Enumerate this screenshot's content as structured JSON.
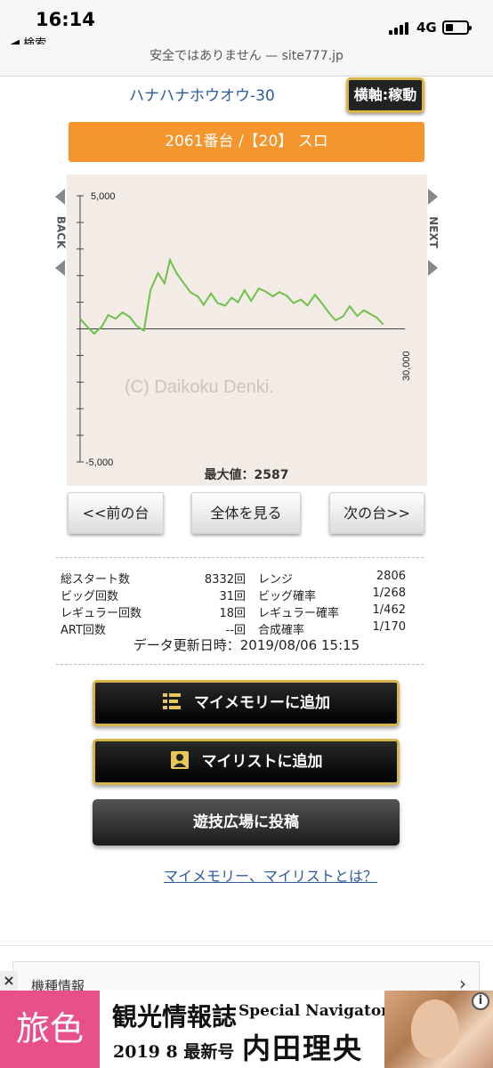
{
  "status_bar": {
    "time": "16:14",
    "back_app": "◀ 検索",
    "network": "4G"
  },
  "url_bar": {
    "text": "安全ではありません — site777.jp"
  },
  "header": {
    "model_name": "ハナハナホウオウ-30",
    "axis_button": "横軸:稼動",
    "machine": "2061番台 /【20】 スロ"
  },
  "chart_data": {
    "type": "line",
    "title": "",
    "xlabel": "",
    "ylabel": "",
    "x_tick_labels": [
      "30,000"
    ],
    "y_tick_labels": [
      "5,000",
      "-5,000"
    ],
    "ylim": [
      -5000,
      5000
    ],
    "xlim": [
      0,
      30000
    ],
    "grid": false,
    "watermark": "(C) Daikoku Denki.",
    "max_label": "最大値：2587",
    "series": [
      {
        "color": "#6ec24a",
        "x": [
          0,
          700,
          1300,
          2000,
          2600,
          3300,
          3900,
          4600,
          5200,
          5900,
          6500,
          7200,
          7800,
          8300,
          8900,
          9600,
          10200,
          10900,
          11400,
          12100,
          12700,
          13400,
          14000,
          14600,
          15200,
          15800,
          16500,
          17100,
          17800,
          18400,
          19100,
          19700,
          20400,
          21000,
          21700,
          22300,
          23000,
          23600,
          24300,
          24900,
          25600,
          26200,
          26800,
          27400,
          28000
        ],
        "y": [
          380,
          60,
          -180,
          80,
          520,
          380,
          620,
          440,
          120,
          -70,
          1460,
          2100,
          1710,
          2587,
          2100,
          1700,
          1370,
          1210,
          900,
          1330,
          970,
          870,
          1170,
          1000,
          1450,
          1050,
          1520,
          1410,
          1220,
          1380,
          1240,
          970,
          1100,
          880,
          1280,
          980,
          600,
          320,
          470,
          850,
          480,
          700,
          560,
          420,
          160
        ]
      }
    ]
  },
  "chart_nav": {
    "back": "BACK",
    "next": "NEXT"
  },
  "pager": {
    "prev": "<<前の台",
    "all": "全体を見る",
    "next": "次の台>>"
  },
  "stats": [
    {
      "label": "総スタート数",
      "value": "8332回",
      "label2": "レンジ",
      "value2": "2806"
    },
    {
      "label": "ビッグ回数",
      "value": "31回",
      "label2": "ビッグ確率",
      "value2": "1/268"
    },
    {
      "label": "レギュラー回数",
      "value": "18回",
      "label2": "レギュラー確率",
      "value2": "1/462"
    },
    {
      "label": "ART回数",
      "value": "--回",
      "label2": "合成確率",
      "value2": "1/170"
    }
  ],
  "updated": "データ更新日時：2019/08/06 15:15",
  "actions": {
    "memory": "マイメモリーに追加",
    "mylist": "マイリストに追加",
    "post": "遊技広場に投稿",
    "help_link": "マイメモリー、マイリストとは？"
  },
  "footer": {
    "spec_label": "機種情報",
    "close": "×"
  },
  "ad": {
    "logo": "旅色",
    "main": "観光情報誌",
    "issue": "2019 8 最新号",
    "navigator": "Special Navigator",
    "name": "内田理央",
    "info": "i"
  }
}
